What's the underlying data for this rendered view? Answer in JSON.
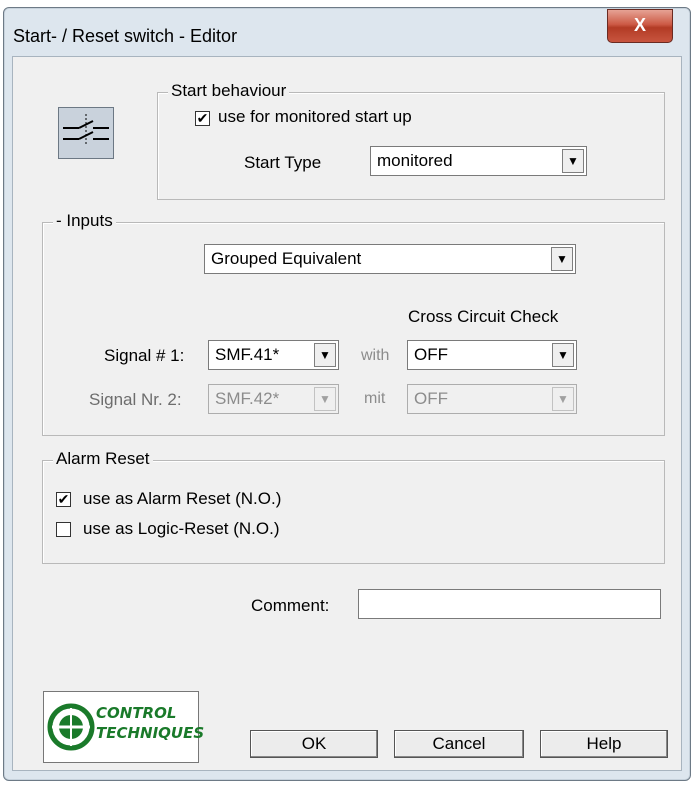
{
  "window": {
    "title": "Start- / Reset switch - Editor",
    "close_glyph": "X"
  },
  "start_behaviour": {
    "legend": "Start behaviour",
    "monitored_checkbox_label": "use for monitored start up",
    "monitored_checked": true,
    "start_type_label": "Start Type",
    "start_type_value": "monitored"
  },
  "inputs": {
    "legend": "- Inputs",
    "mode_value": "Grouped Equivalent",
    "cross_check_header": "Cross Circuit Check",
    "signal1_label": "Signal # 1:",
    "signal1_value": "SMF.41*",
    "signal1_with": "with",
    "signal1_check": "OFF",
    "signal2_label": "Signal Nr. 2:",
    "signal2_value": "SMF.42*",
    "signal2_with": "mit",
    "signal2_check": "OFF"
  },
  "alarm_reset": {
    "legend": "Alarm Reset",
    "alarm_label": "use as Alarm Reset (N.O.)",
    "alarm_checked": true,
    "logic_label": "use as Logic-Reset (N.O.)",
    "logic_checked": false
  },
  "comment": {
    "label": "Comment:",
    "value": ""
  },
  "logo": {
    "line1": "CONTROL",
    "line2": "TECHNIQUES",
    "color": "#1a7a2a"
  },
  "buttons": {
    "ok": "OK",
    "cancel": "Cancel",
    "help": "Help"
  },
  "icons": {
    "switch": "switch-contact-icon",
    "dropdown": "chevron-down-icon",
    "check": "checkmark-icon"
  }
}
